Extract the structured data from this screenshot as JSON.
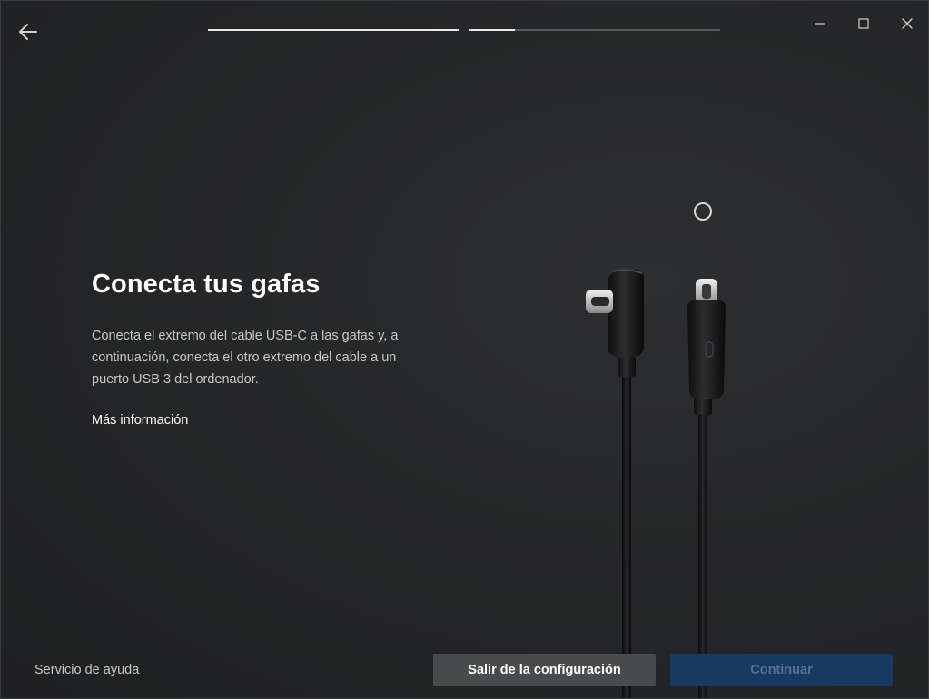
{
  "nav": {
    "back_icon": "arrow-left-icon"
  },
  "progress": {
    "steps": [
      {
        "fill": 1.0
      },
      {
        "fill": 0.18
      }
    ]
  },
  "window_controls": {
    "minimize_icon": "minimize-icon",
    "maximize_icon": "maximize-icon",
    "close_icon": "close-icon"
  },
  "main": {
    "title": "Conecta tus gafas",
    "description": "Conecta el extremo del cable USB-C a las gafas y, a continuación, conecta el otro extremo del cable a un puerto USB 3 del ordenador.",
    "more_info": "Más información",
    "spinner_icon": "loading-spinner-icon",
    "illustration": "usb-c-cable-illustration"
  },
  "footer": {
    "help": "Servicio de ayuda",
    "exit_button": "Salir de la configuración",
    "continue_button": "Continuar",
    "continue_enabled": false
  },
  "colors": {
    "background": "#232425",
    "continue_disabled_bg": "#163a63",
    "continue_disabled_text": "#5c7190",
    "secondary_button_bg": "#4a4b4d"
  }
}
